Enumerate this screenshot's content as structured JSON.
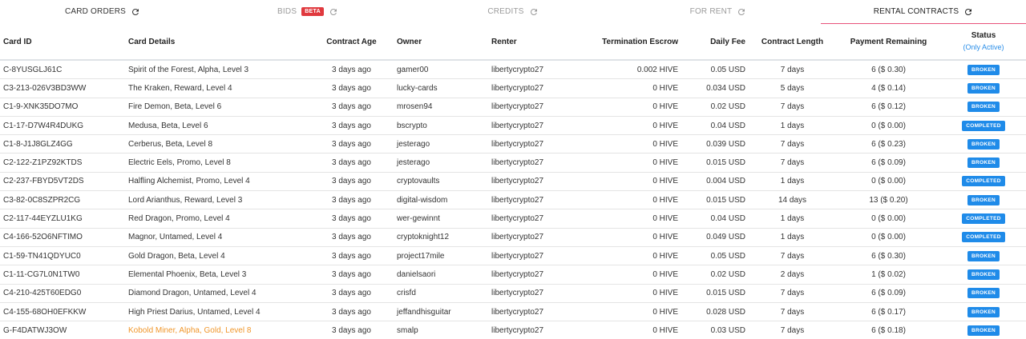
{
  "tabs": [
    {
      "label": "CARD ORDERS",
      "badge": ""
    },
    {
      "label": "BIDS",
      "badge": "BETA"
    },
    {
      "label": "CREDITS",
      "badge": ""
    },
    {
      "label": "FOR RENT",
      "badge": ""
    },
    {
      "label": "RENTAL CONTRACTS",
      "badge": ""
    }
  ],
  "table": {
    "headers": {
      "card_id": "Card ID",
      "card_details": "Card Details",
      "contract_age": "Contract Age",
      "owner": "Owner",
      "renter": "Renter",
      "termination_escrow": "Termination Escrow",
      "daily_fee": "Daily Fee",
      "contract_length": "Contract Length",
      "payment_remaining": "Payment Remaining",
      "status": "Status",
      "status_filter": "(Only Active)"
    },
    "rows": [
      {
        "card_id": "C-8YUSGLJ61C",
        "details": "Spirit of the Forest, Alpha, Level 3",
        "age": "3 days ago",
        "owner": "gamer00",
        "renter": "libertycrypto27",
        "escrow": "0.002 HIVE",
        "fee": "0.05 USD",
        "length": "7 days",
        "payment": "6 ($ 0.30)",
        "status": "BROKEN"
      },
      {
        "card_id": "C3-213-026V3BD3WW",
        "details": "The Kraken, Reward, Level 4",
        "age": "3 days ago",
        "owner": "lucky-cards",
        "renter": "libertycrypto27",
        "escrow": "0 HIVE",
        "fee": "0.034 USD",
        "length": "5 days",
        "payment": "4 ($ 0.14)",
        "status": "BROKEN"
      },
      {
        "card_id": "C1-9-XNK35DO7MO",
        "details": "Fire Demon, Beta, Level 6",
        "age": "3 days ago",
        "owner": "mrosen94",
        "renter": "libertycrypto27",
        "escrow": "0 HIVE",
        "fee": "0.02 USD",
        "length": "7 days",
        "payment": "6 ($ 0.12)",
        "status": "BROKEN"
      },
      {
        "card_id": "C1-17-D7W4R4DUKG",
        "details": "Medusa, Beta, Level 6",
        "age": "3 days ago",
        "owner": "bscrypto",
        "renter": "libertycrypto27",
        "escrow": "0 HIVE",
        "fee": "0.04 USD",
        "length": "1 days",
        "payment": "0 ($ 0.00)",
        "status": "COMPLETED"
      },
      {
        "card_id": "C1-8-J1J8GLZ4GG",
        "details": "Cerberus, Beta, Level 8",
        "age": "3 days ago",
        "owner": "jesterago",
        "renter": "libertycrypto27",
        "escrow": "0 HIVE",
        "fee": "0.039 USD",
        "length": "7 days",
        "payment": "6 ($ 0.23)",
        "status": "BROKEN"
      },
      {
        "card_id": "C2-122-Z1PZ92KTDS",
        "details": "Electric Eels, Promo, Level 8",
        "age": "3 days ago",
        "owner": "jesterago",
        "renter": "libertycrypto27",
        "escrow": "0 HIVE",
        "fee": "0.015 USD",
        "length": "7 days",
        "payment": "6 ($ 0.09)",
        "status": "BROKEN"
      },
      {
        "card_id": "C2-237-FBYD5VT2DS",
        "details": "Halfling Alchemist, Promo, Level 4",
        "age": "3 days ago",
        "owner": "cryptovaults",
        "renter": "libertycrypto27",
        "escrow": "0 HIVE",
        "fee": "0.004 USD",
        "length": "1 days",
        "payment": "0 ($ 0.00)",
        "status": "COMPLETED"
      },
      {
        "card_id": "C3-82-0C8SZPR2CG",
        "details": "Lord Arianthus, Reward, Level 3",
        "age": "3 days ago",
        "owner": "digital-wisdom",
        "renter": "libertycrypto27",
        "escrow": "0 HIVE",
        "fee": "0.015 USD",
        "length": "14 days",
        "payment": "13 ($ 0.20)",
        "status": "BROKEN"
      },
      {
        "card_id": "C2-117-44EYZLU1KG",
        "details": "Red Dragon, Promo, Level 4",
        "age": "3 days ago",
        "owner": "wer-gewinnt",
        "renter": "libertycrypto27",
        "escrow": "0 HIVE",
        "fee": "0.04 USD",
        "length": "1 days",
        "payment": "0 ($ 0.00)",
        "status": "COMPLETED"
      },
      {
        "card_id": "C4-166-52O6NFTIMO",
        "details": "Magnor, Untamed, Level 4",
        "age": "3 days ago",
        "owner": "cryptoknight12",
        "renter": "libertycrypto27",
        "escrow": "0 HIVE",
        "fee": "0.049 USD",
        "length": "1 days",
        "payment": "0 ($ 0.00)",
        "status": "COMPLETED"
      },
      {
        "card_id": "C1-59-TN41QDYUC0",
        "details": "Gold Dragon, Beta, Level 4",
        "age": "3 days ago",
        "owner": "project17mile",
        "renter": "libertycrypto27",
        "escrow": "0 HIVE",
        "fee": "0.05 USD",
        "length": "7 days",
        "payment": "6 ($ 0.30)",
        "status": "BROKEN"
      },
      {
        "card_id": "C1-11-CG7L0N1TW0",
        "details": "Elemental Phoenix, Beta, Level 3",
        "age": "3 days ago",
        "owner": "danielsaori",
        "renter": "libertycrypto27",
        "escrow": "0 HIVE",
        "fee": "0.02 USD",
        "length": "2 days",
        "payment": "1 ($ 0.02)",
        "status": "BROKEN"
      },
      {
        "card_id": "C4-210-425T60EDG0",
        "details": "Diamond Dragon, Untamed, Level 4",
        "age": "3 days ago",
        "owner": "crisfd",
        "renter": "libertycrypto27",
        "escrow": "0 HIVE",
        "fee": "0.015 USD",
        "length": "7 days",
        "payment": "6 ($ 0.09)",
        "status": "BROKEN"
      },
      {
        "card_id": "C4-155-68OH0EFKKW",
        "details": "High Priest Darius, Untamed, Level 4",
        "age": "3 days ago",
        "owner": "jeffandhisguitar",
        "renter": "libertycrypto27",
        "escrow": "0 HIVE",
        "fee": "0.028 USD",
        "length": "7 days",
        "payment": "6 ($ 0.17)",
        "status": "BROKEN"
      },
      {
        "card_id": "G-F4DATWJ3OW",
        "details": "Kobold Miner, Alpha, Gold, Level 8",
        "age": "3 days ago",
        "owner": "smalp",
        "renter": "libertycrypto27",
        "escrow": "0 HIVE",
        "fee": "0.03 USD",
        "length": "7 days",
        "payment": "6 ($ 0.18)",
        "status": "BROKEN",
        "gold": true
      }
    ]
  },
  "colors": {
    "status_pill": "#1f8be9",
    "beta_badge": "#e0393e",
    "active_tab_underline": "#e8527a",
    "gold_card_text": "#f0962a",
    "link_blue": "#2a8ee8"
  },
  "icons": {
    "tab_refresh": "refresh-icon"
  }
}
